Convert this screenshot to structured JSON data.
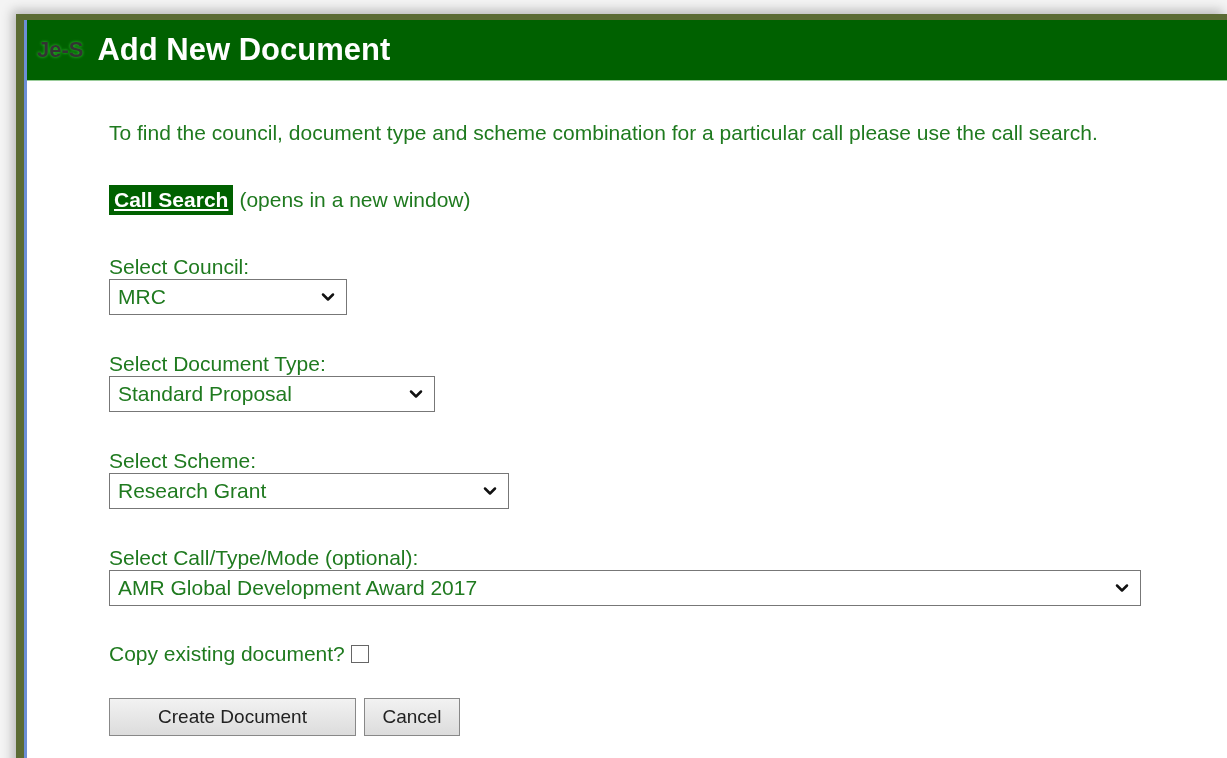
{
  "header": {
    "logo": "Je-S",
    "title": "Add New Document"
  },
  "intro": "To find the council, document type and scheme combination for a particular call please use the call search.",
  "call_search": {
    "link": "Call Search",
    "note": "(opens in a new window)"
  },
  "selects": [
    {
      "label": "Select Council:",
      "value": "MRC",
      "kind": "small"
    },
    {
      "label": "Select Document Type:",
      "value": "Standard Proposal",
      "kind": "medium"
    },
    {
      "label": "Select Scheme:",
      "value": "Research Grant",
      "kind": "large"
    },
    {
      "label": "Select Call/Type/Mode (optional):",
      "value": "AMR Global Development Award 2017",
      "kind": "full"
    }
  ],
  "copy_existing": {
    "label": "Copy existing document?",
    "checked": false
  },
  "buttons": [
    {
      "label": "Create Document",
      "kind": "wide"
    },
    {
      "label": "Cancel",
      "kind": "narrow"
    }
  ]
}
